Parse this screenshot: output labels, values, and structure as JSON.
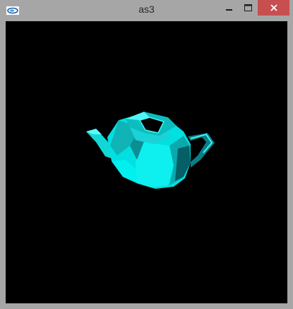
{
  "window": {
    "title": "as3",
    "icon": "opengl-app-icon",
    "controls": {
      "minimize": "minimize-icon",
      "maximize": "maximize-icon",
      "close": "close-icon"
    }
  },
  "scene": {
    "background": "#000000",
    "object": "teapot",
    "object_color": "#00e5e5"
  }
}
